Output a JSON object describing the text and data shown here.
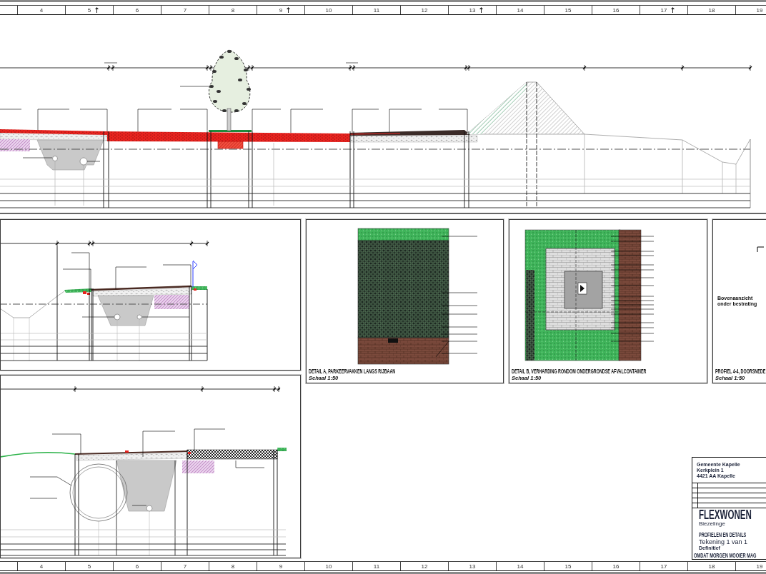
{
  "ruler_top": [
    {
      "label": "4"
    },
    {
      "label": "5",
      "centre_mark": true
    },
    {
      "label": "6"
    },
    {
      "label": "7"
    },
    {
      "label": "8"
    },
    {
      "label": "9",
      "centre_mark": true
    },
    {
      "label": "10"
    },
    {
      "label": "11"
    },
    {
      "label": "12"
    },
    {
      "label": "13",
      "centre_mark": true
    },
    {
      "label": "14"
    },
    {
      "label": "15"
    },
    {
      "label": "16"
    },
    {
      "label": "17",
      "centre_mark": true
    },
    {
      "label": "18"
    },
    {
      "label": "19"
    }
  ],
  "panels": [
    {
      "kind": "road-profile"
    },
    {
      "kind": "street-profile"
    },
    {
      "kind": "parking-detail",
      "title": "DETAIL A, PARKEERVAKKEN LANGS RIJBAAN",
      "scale": "Schaal 1:50"
    },
    {
      "kind": "container-detail",
      "title": "DETAIL B, VERHARDING RONDOM ONDERGRONDSE AFVALCONTAINER",
      "scale": "Schaal 1:50"
    },
    {
      "kind": "section-profile",
      "note": "Bovenaanzicht onder bestrating",
      "title": "PROFIEL 4-4, DOORSNEDE",
      "scale": "Schaal 1:50"
    },
    {
      "kind": "pipe-profile"
    }
  ],
  "title_block": {
    "client": [
      "Gemeente Kapelle",
      "Kerkplein 1",
      "4421 AA Kapelle"
    ],
    "project": "FLEXWONEN",
    "place": "Biezelinge",
    "subject": "PROFIELEN EN DETAILS",
    "sheet": "Tekening 1 van 1",
    "status": "Definitief",
    "slogan": "OMDAT MORGEN MOOIER MAG"
  },
  "ruler_bottom": [
    {
      "label": "4"
    },
    {
      "label": "5"
    },
    {
      "label": "6"
    },
    {
      "label": "7"
    },
    {
      "label": "8"
    },
    {
      "label": "9"
    },
    {
      "label": "10"
    },
    {
      "label": "11"
    },
    {
      "label": "12"
    },
    {
      "label": "13"
    },
    {
      "label": "14"
    },
    {
      "label": "15"
    },
    {
      "label": "16"
    },
    {
      "label": "17"
    },
    {
      "label": "18"
    },
    {
      "label": "19"
    }
  ]
}
